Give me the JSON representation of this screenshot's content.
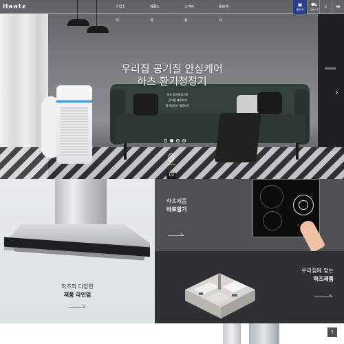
{
  "header": {
    "logo": "Haatz",
    "nav": [
      "기업소개",
      "제품소개",
      "고객지원",
      "홍보센터"
    ],
    "store_button": {
      "icon": "store-icon",
      "label": "제품구매"
    },
    "cart_button": {
      "icon": "cart-icon",
      "label": "장바구니"
    },
    "search_icon": "search-icon",
    "menu_icon": "menu-icon",
    "colors": {
      "store_button_bg": "#2a3f8a"
    }
  },
  "hero": {
    "title_line1": "우리집 공기질 안심케어",
    "title_line2": "하츠 환기청정기",
    "sub_line1": "하츠 환기청정기로",
    "sub_line2": "공기를 깨끗하게",
    "sub_line3": "환기청정기 제품보기",
    "slide_dots": {
      "count": 4,
      "active_index": 1
    },
    "scroll_label": "SCROLL",
    "slide_counter": "1/4",
    "prev_icon": "chevron-left-icon",
    "next_icon": "chevron-right-icon"
  },
  "products": {
    "hood": {
      "line1": "하츠의 다양한",
      "line2": "제품 라인업"
    },
    "cooktop": {
      "line1": "하츠제품",
      "line2": "바로알기"
    },
    "floorplan": {
      "line1": "우리집에 맞는",
      "line2": "하츠제품"
    }
  },
  "top_button": "↑"
}
